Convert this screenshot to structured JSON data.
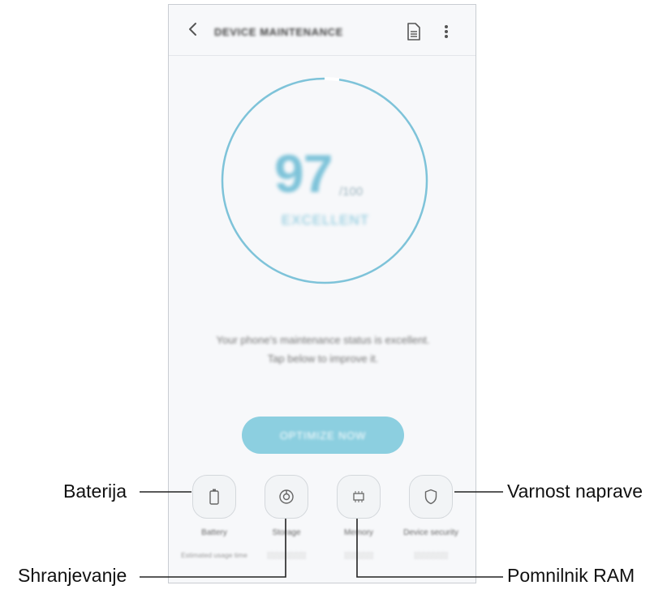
{
  "app": {
    "title": "DEVICE MAINTENANCE",
    "score": "97",
    "score_max": "/100",
    "status": "EXCELLENT",
    "description_line1": "Your phone's maintenance status is excellent.",
    "description_line2": "Tap below to improve it.",
    "optimize_button": "OPTIMIZE NOW",
    "ring_accent": "#7ec3d9"
  },
  "tiles": [
    {
      "label": "Battery",
      "sub1": "Estimated usage time",
      "sub2": "",
      "icon": "battery-icon"
    },
    {
      "label": "Storage",
      "sub1": "",
      "sub2": "",
      "icon": "storage-icon"
    },
    {
      "label": "Memory",
      "sub1": "",
      "sub2": "",
      "icon": "memory-icon"
    },
    {
      "label": "Device security",
      "sub1": "",
      "sub2": "",
      "icon": "shield-icon"
    }
  ],
  "callouts": {
    "battery": "Baterija",
    "storage": "Shranjevanje",
    "memory": "Pomnilnik RAM",
    "security": "Varnost naprave"
  }
}
